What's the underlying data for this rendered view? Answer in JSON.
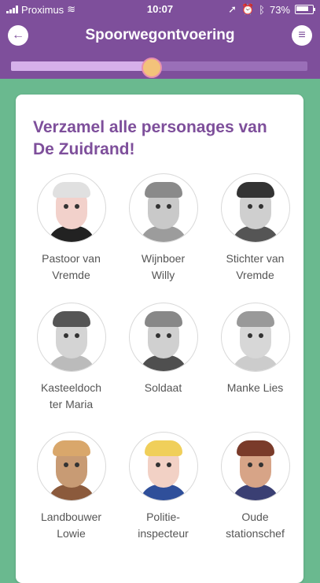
{
  "status": {
    "carrier": "Proximus",
    "time": "10:07",
    "battery": "73%"
  },
  "header": {
    "title": "Spoorwegontvoering",
    "back_icon": "arrow-left-icon",
    "menu_icon": "hamburger-menu-icon"
  },
  "progress": {
    "fraction": 0.47
  },
  "card": {
    "heading": "Verzamel alle personages van De Zuidrand!"
  },
  "characters": [
    {
      "label": "Pastoor van\nVremde",
      "skin": "#f2d1cb",
      "hair": "#e0e0e0",
      "clothes": "#222222"
    },
    {
      "label": "Wijnboer\nWilly",
      "skin": "#c9c9c9",
      "hair": "#8a8a8a",
      "clothes": "#9c9c9c"
    },
    {
      "label": "Stichter van\nVremde",
      "skin": "#cfcfcf",
      "hair": "#333333",
      "clothes": "#555555"
    },
    {
      "label": "Kasteeldoch\nter Maria",
      "skin": "#d4d4d4",
      "hair": "#555555",
      "clothes": "#bbbbbb"
    },
    {
      "label": "Soldaat",
      "skin": "#d0d0d0",
      "hair": "#888888",
      "clothes": "#4f4f4f"
    },
    {
      "label": "Manke Lies",
      "skin": "#d7d7d7",
      "hair": "#999999",
      "clothes": "#cccccc"
    },
    {
      "label": "Landbouwer\nLowie",
      "skin": "#c89b74",
      "hair": "#d9a76b",
      "clothes": "#8b5a3c"
    },
    {
      "label": "Politie-\ninspecteur",
      "skin": "#f2d1c5",
      "hair": "#f0cf5a",
      "clothes": "#2f4f9a"
    },
    {
      "label": "Oude\nstationschef",
      "skin": "#d7a487",
      "hair": "#7a3b2a",
      "clothes": "#3a3f73"
    }
  ]
}
